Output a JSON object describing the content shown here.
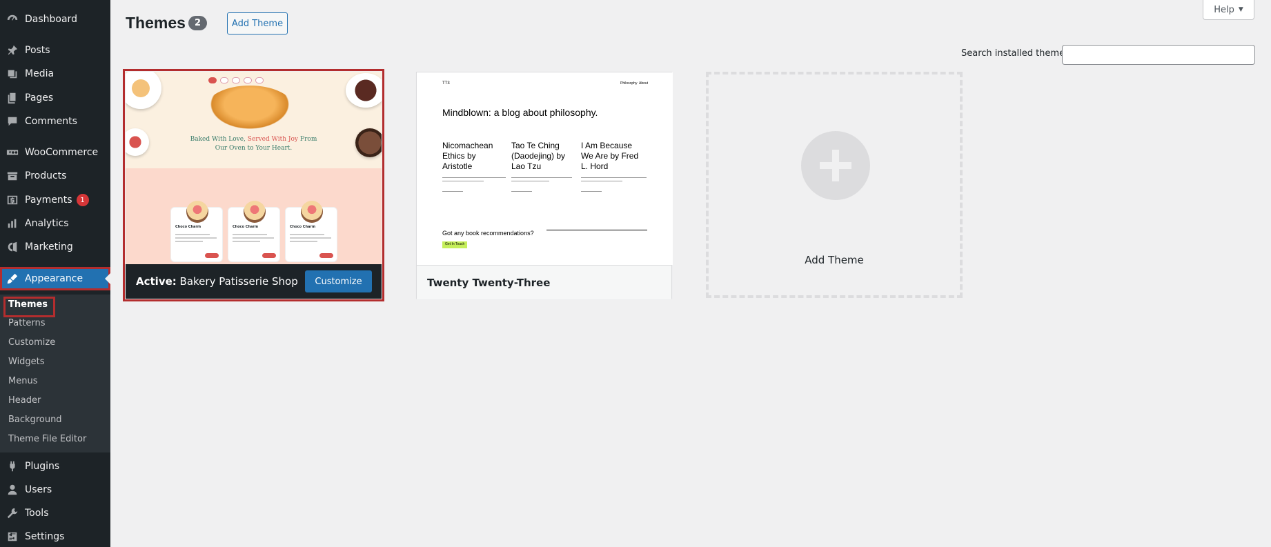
{
  "sidebar": {
    "items": [
      {
        "label": "Dashboard",
        "icon": "dashboard-icon"
      },
      {
        "label": "Posts",
        "icon": "pin-icon"
      },
      {
        "label": "Media",
        "icon": "media-icon"
      },
      {
        "label": "Pages",
        "icon": "pages-icon"
      },
      {
        "label": "Comments",
        "icon": "comment-icon"
      },
      {
        "label": "WooCommerce",
        "icon": "woo-icon"
      },
      {
        "label": "Products",
        "icon": "archive-icon"
      },
      {
        "label": "Payments",
        "icon": "dollar-icon",
        "badge": "1"
      },
      {
        "label": "Analytics",
        "icon": "bar-chart-icon"
      },
      {
        "label": "Marketing",
        "icon": "megaphone-icon"
      },
      {
        "label": "Appearance",
        "icon": "brush-icon"
      },
      {
        "label": "Plugins",
        "icon": "plug-icon"
      },
      {
        "label": "Users",
        "icon": "user-icon"
      },
      {
        "label": "Tools",
        "icon": "wrench-icon"
      },
      {
        "label": "Settings",
        "icon": "settings-icon"
      }
    ],
    "submenu": [
      "Themes",
      "Patterns",
      "Customize",
      "Widgets",
      "Menus",
      "Header",
      "Background",
      "Theme File Editor"
    ]
  },
  "header": {
    "title": "Themes",
    "count": "2",
    "add_button": "Add Theme",
    "help": "Help"
  },
  "search": {
    "label": "Search installed themes",
    "value": ""
  },
  "themes": {
    "active": {
      "prefix": "Active:",
      "name": "Bakery Patisserie Shop",
      "customize": "Customize",
      "preview": {
        "headline_1": "Baked With Love,",
        "headline_2": "Served With Joy",
        "headline_3": "From",
        "headline_4": "Our Oven to Your Heart.",
        "cake_title": "Choco Charm"
      }
    },
    "second": {
      "name": "Twenty Twenty-Three",
      "preview": {
        "logo": "TT3",
        "nav_1": "Philosophy",
        "nav_2": "About",
        "heading": "Mindblown: a blog about philosophy.",
        "post_1": "Nicomachean Ethics by Aristotle",
        "post_2": "Tao Te Ching (Daodejing) by Lao Tzu",
        "post_3": "I Am Because We Are by Fred L. Hord",
        "cta": "Got any book recommendations?",
        "button": "Get In Touch"
      }
    },
    "add_card_label": "Add Theme"
  },
  "colors": {
    "sidebar_bg": "#1d2327",
    "accent": "#2271b1",
    "highlight_border": "#b32d2e",
    "badge": "#d63638"
  }
}
